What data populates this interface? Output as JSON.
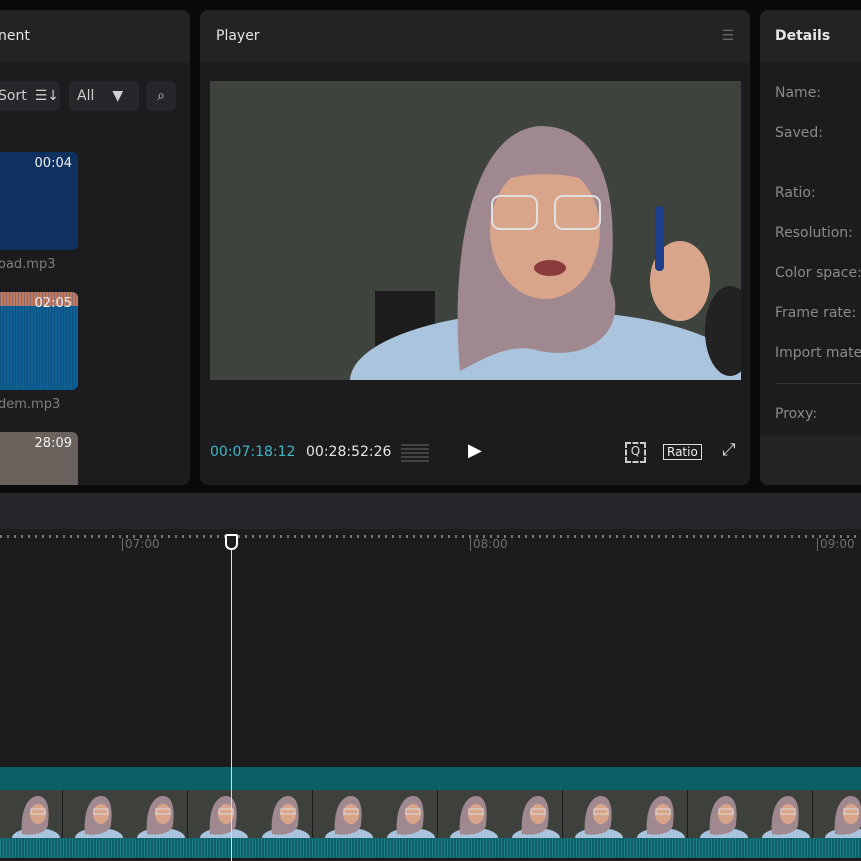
{
  "media": {
    "title_fragment": "nent",
    "sort_label": "Sort",
    "filter_label": "All",
    "items": [
      {
        "duration": "00:04",
        "name": "oad.mp3"
      },
      {
        "duration": "02:05",
        "name": "dem.mp3"
      },
      {
        "duration": "28:09",
        "name": ""
      }
    ]
  },
  "player": {
    "title": "Player",
    "current_time": "00:07:18:12",
    "total_time": "00:28:52:26",
    "ratio_label": "Ratio"
  },
  "details": {
    "title": "Details",
    "labels": [
      "Name:",
      "Saved:",
      "Ratio:",
      "Resolution:",
      "Color space:",
      "Frame rate:",
      "Import mate",
      "Proxy:"
    ]
  },
  "timeline": {
    "ticks": [
      "07:00",
      "08:00",
      "09:00"
    ]
  },
  "colors": {
    "accent": "#3fb6c4",
    "track": "#0a6066"
  }
}
